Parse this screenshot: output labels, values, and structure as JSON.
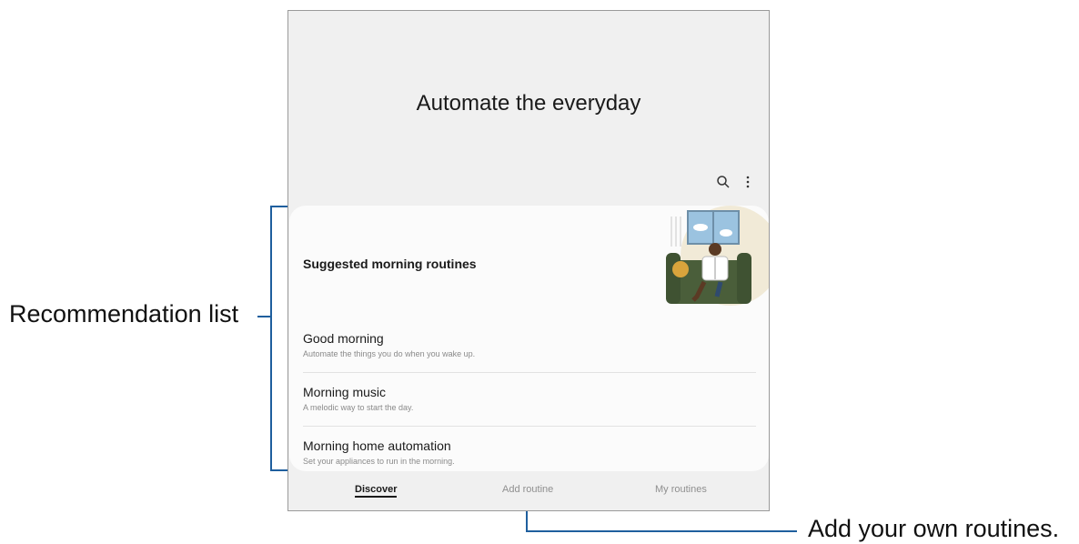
{
  "screen": {
    "hero_title": "Automate the everyday",
    "toolbar": {
      "search_icon": "search-icon",
      "more_icon": "more-options-icon"
    },
    "recommendations": {
      "section_title": "Suggested morning routines",
      "items": [
        {
          "title": "Good morning",
          "subtitle": "Automate the things you do when you wake up."
        },
        {
          "title": "Morning music",
          "subtitle": "A melodic way to start the day."
        },
        {
          "title": "Morning home automation",
          "subtitle": "Set your appliances to run in the morning."
        }
      ]
    },
    "tabs": [
      {
        "label": "Discover",
        "active": true
      },
      {
        "label": "Add routine",
        "active": false
      },
      {
        "label": "My routines",
        "active": false
      }
    ]
  },
  "annotations": {
    "recommendation_list": "Recommendation list",
    "add_routine": "Add your own routines."
  },
  "colors": {
    "callout_line": "#1f5f9e",
    "sofa": "#4a5e3a",
    "window": "#9bc3e0"
  }
}
